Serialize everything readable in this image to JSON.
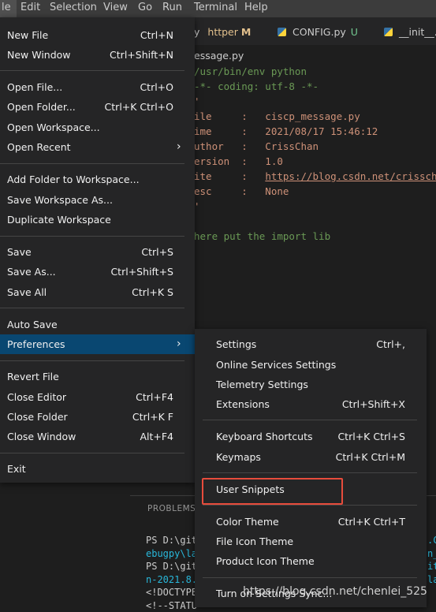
{
  "menubar": {
    "items": [
      "le",
      "Edit",
      "Selection",
      "View",
      "Go",
      "Run",
      "Terminal",
      "Help"
    ]
  },
  "tabs": [
    {
      "label": "y",
      "sub": "httper",
      "badge": "M"
    },
    {
      "label": "CONFIG.py",
      "badge": "U"
    },
    {
      "label": "__init__.p"
    }
  ],
  "breadcrumb": "essage.py",
  "code": [
    "/usr/bin/env python",
    "-*- coding: utf-8 -*-",
    "'",
    "ile     :   ciscp_message.py",
    "ime     :   2021/08/17 15:46:12",
    "uthor   :   CrissChan",
    "ersion  :   1.0",
    "ite     :   ",
    "esc     :   None",
    "'",
    "",
    "here put the import lib"
  ],
  "site_url": "https://blog.csdn.net/crissch",
  "panel": {
    "title": "PROBLEMS",
    "lines": [
      "PS D:\\git",
      "ebugpy\\la",
      "PS D:\\git",
      "n-2021.8.",
      "<!DOCTYPE",
      "<!--STATU"
    ],
    "right_fragments": [
      ".Ch",
      "n_l",
      "it",
      "la"
    ]
  },
  "file_menu": {
    "items": [
      {
        "label": "New File",
        "key": "Ctrl+N"
      },
      {
        "label": "New Window",
        "key": "Ctrl+Shift+N"
      },
      {
        "label": "Open File...",
        "key": "Ctrl+O"
      },
      {
        "label": "Open Folder...",
        "key": "Ctrl+K Ctrl+O"
      },
      {
        "label": "Open Workspace...",
        "key": ""
      },
      {
        "label": "Open Recent",
        "key": ""
      },
      {
        "label": "Add Folder to Workspace...",
        "key": ""
      },
      {
        "label": "Save Workspace As...",
        "key": ""
      },
      {
        "label": "Duplicate Workspace",
        "key": ""
      },
      {
        "label": "Save",
        "key": "Ctrl+S"
      },
      {
        "label": "Save As...",
        "key": "Ctrl+Shift+S"
      },
      {
        "label": "Save All",
        "key": "Ctrl+K S"
      },
      {
        "label": "Auto Save",
        "key": ""
      },
      {
        "label": "Preferences",
        "key": ""
      },
      {
        "label": "Revert File",
        "key": ""
      },
      {
        "label": "Close Editor",
        "key": "Ctrl+F4"
      },
      {
        "label": "Close Folder",
        "key": "Ctrl+K F"
      },
      {
        "label": "Close Window",
        "key": "Alt+F4"
      },
      {
        "label": "Exit",
        "key": ""
      }
    ]
  },
  "prefs_menu": {
    "items": [
      {
        "label": "Settings",
        "key": "Ctrl+,"
      },
      {
        "label": "Online Services Settings",
        "key": ""
      },
      {
        "label": "Telemetry Settings",
        "key": ""
      },
      {
        "label": "Extensions",
        "key": "Ctrl+Shift+X"
      },
      {
        "label": "Keyboard Shortcuts",
        "key": "Ctrl+K Ctrl+S"
      },
      {
        "label": "Keymaps",
        "key": "Ctrl+K Ctrl+M"
      },
      {
        "label": "User Snippets",
        "key": ""
      },
      {
        "label": "Color Theme",
        "key": "Ctrl+K Ctrl+T"
      },
      {
        "label": "File Icon Theme",
        "key": ""
      },
      {
        "label": "Product Icon Theme",
        "key": ""
      },
      {
        "label": "Turn on Settings Sync...",
        "key": ""
      }
    ]
  },
  "watermark": "https://blog.csdn.net/chenlei_525",
  "colors": {
    "selection": "#094771",
    "highlight_box": "#e74c3c",
    "menu_bg": "#252526"
  }
}
